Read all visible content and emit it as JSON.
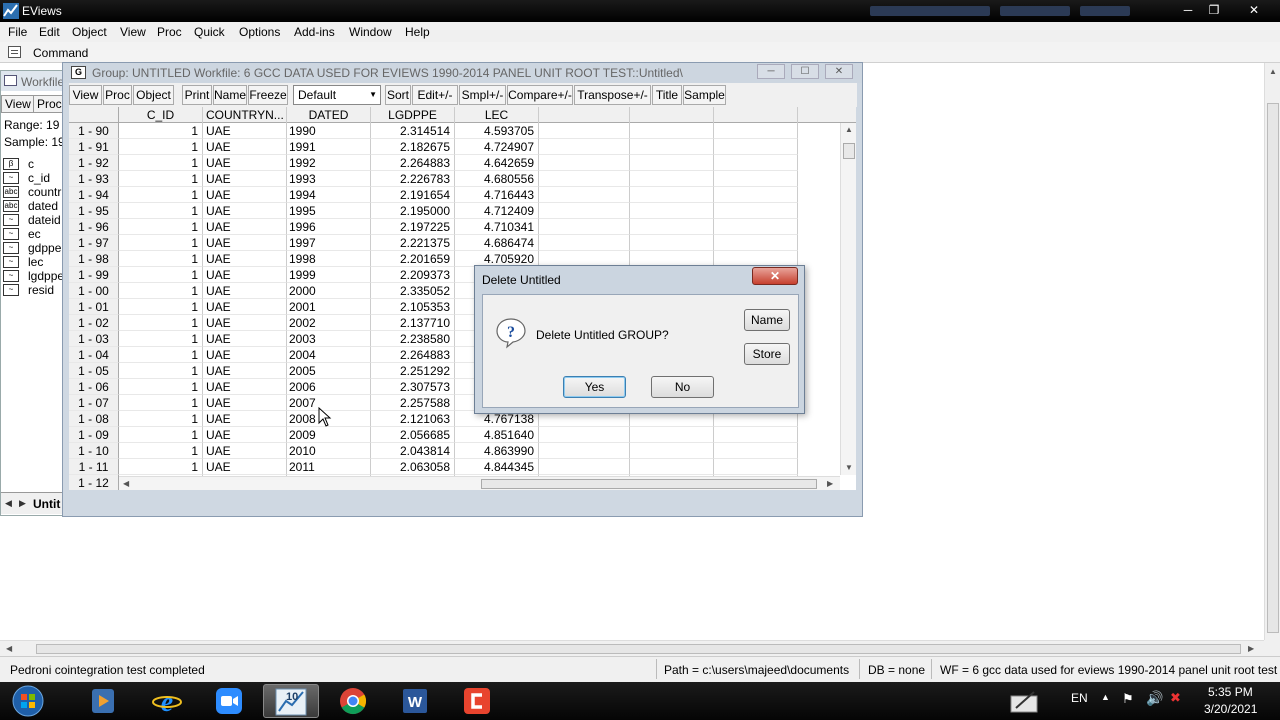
{
  "app": {
    "title": "EViews",
    "menu": [
      "File",
      "Edit",
      "Object",
      "View",
      "Proc",
      "Quick",
      "Options",
      "Add-ins",
      "Window",
      "Help"
    ],
    "command_label": "Command"
  },
  "workfile": {
    "title": "Workfile",
    "toolbar": [
      "View",
      "Proc"
    ],
    "range_label": "Range:  19",
    "sample_label": "Sample: 19",
    "objects": [
      {
        "icon": "β",
        "name": "c"
      },
      {
        "icon": "~",
        "name": "c_id"
      },
      {
        "icon": "abc",
        "name": "countr"
      },
      {
        "icon": "abc",
        "name": "dated"
      },
      {
        "icon": "~",
        "name": "dateid"
      },
      {
        "icon": "~",
        "name": "ec"
      },
      {
        "icon": "~",
        "name": "gdppe"
      },
      {
        "icon": "~",
        "name": "lec"
      },
      {
        "icon": "~",
        "name": "lgdppe"
      },
      {
        "icon": "~",
        "name": "resid"
      }
    ],
    "tab_label": "Untit"
  },
  "group": {
    "title": "Group: UNTITLED   Workfile: 6 GCC DATA USED FOR EVIEWS 1990-2014 PANEL UNIT ROOT TEST::Untitled\\",
    "toolbar": [
      "View",
      "Proc",
      "Object",
      "Print",
      "Name",
      "Freeze",
      "Sort",
      "Edit+/-",
      "Smpl+/-",
      "Compare+/-",
      "Transpose+/-",
      "Title",
      "Sample"
    ],
    "display_select": "Default",
    "columns": [
      "C_ID",
      "COUNTRYN...",
      "DATED",
      "LGDPPE",
      "LEC"
    ],
    "rows": [
      [
        "1 - 90",
        "1",
        "UAE",
        "1990",
        "2.314514",
        "4.593705"
      ],
      [
        "1 - 91",
        "1",
        "UAE",
        "1991",
        "2.182675",
        "4.724907"
      ],
      [
        "1 - 92",
        "1",
        "UAE",
        "1992",
        "2.264883",
        "4.642659"
      ],
      [
        "1 - 93",
        "1",
        "UAE",
        "1993",
        "2.226783",
        "4.680556"
      ],
      [
        "1 - 94",
        "1",
        "UAE",
        "1994",
        "2.191654",
        "4.716443"
      ],
      [
        "1 - 95",
        "1",
        "UAE",
        "1995",
        "2.195000",
        "4.712409"
      ],
      [
        "1 - 96",
        "1",
        "UAE",
        "1996",
        "2.197225",
        "4.710341"
      ],
      [
        "1 - 97",
        "1",
        "UAE",
        "1997",
        "2.221375",
        "4.686474"
      ],
      [
        "1 - 98",
        "1",
        "UAE",
        "1998",
        "2.201659",
        "4.705920"
      ],
      [
        "1 - 99",
        "1",
        "UAE",
        "1999",
        "2.209373",
        ""
      ],
      [
        "1 - 00",
        "1",
        "UAE",
        "2000",
        "2.335052",
        ""
      ],
      [
        "1 - 01",
        "1",
        "UAE",
        "2001",
        "2.105353",
        ""
      ],
      [
        "1 - 02",
        "1",
        "UAE",
        "2002",
        "2.137710",
        ""
      ],
      [
        "1 - 03",
        "1",
        "UAE",
        "2003",
        "2.238580",
        ""
      ],
      [
        "1 - 04",
        "1",
        "UAE",
        "2004",
        "2.264883",
        ""
      ],
      [
        "1 - 05",
        "1",
        "UAE",
        "2005",
        "2.251292",
        ""
      ],
      [
        "1 - 06",
        "1",
        "UAE",
        "2006",
        "2.307573",
        ""
      ],
      [
        "1 - 07",
        "1",
        "UAE",
        "2007",
        "2.257588",
        ""
      ],
      [
        "1 - 08",
        "1",
        "UAE",
        "2008",
        "2.121063",
        "4.767138"
      ],
      [
        "1 - 09",
        "1",
        "UAE",
        "2009",
        "2.056685",
        "4.851640"
      ],
      [
        "1 - 10",
        "1",
        "UAE",
        "2010",
        "2.043814",
        "4.863990"
      ],
      [
        "1 - 11",
        "1",
        "UAE",
        "2011",
        "2.063058",
        "4.844345"
      ],
      [
        "1 - 12",
        "",
        "",
        "",
        "",
        ""
      ]
    ]
  },
  "dialog": {
    "title": "Delete Untitled",
    "close_glyph": "✕",
    "message": "Delete Untitled GROUP?",
    "yes": "Yes",
    "no": "No",
    "name": "Name",
    "store": "Store"
  },
  "status": {
    "message": "Pedroni cointegration test completed",
    "path": "Path = c:\\users\\majeed\\documents",
    "db": "DB = none",
    "wf": "WF = 6 gcc data used for eviews 1990-2014 panel unit root test"
  },
  "taskbar": {
    "apps": [
      "start-orb-icon",
      "media-player-icon",
      "internet-explorer-icon",
      "zoom-icon",
      "eviews-10-icon",
      "chrome-icon",
      "word-icon",
      "camtasia-icon"
    ],
    "eviews_badge": "10",
    "word_letter": "W",
    "lang": "EN",
    "time": "5:35 PM",
    "date": "3/20/2021"
  },
  "colors": {
    "dialog_close": "#c7402e",
    "title_inactive": "#666666",
    "selection_border": "#3c7fb1"
  }
}
